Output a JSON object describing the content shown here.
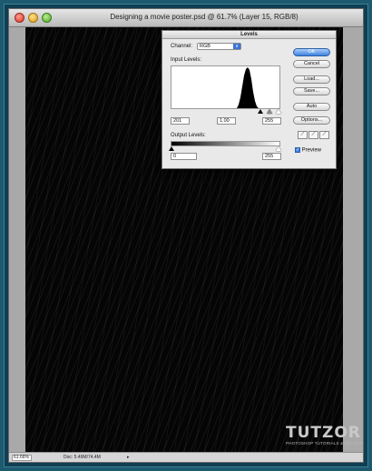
{
  "window": {
    "title": "Designing a movie poster.psd @ 61.7% (Layer 15, RGB/8)"
  },
  "statusbar": {
    "zoom": "61.66%",
    "doc_info": "Doc: 5.49M/74.4M",
    "arrow": "▸"
  },
  "watermark": {
    "logo": "TUTZOR",
    "tagline": "PHOTOSHOP TUTORIALS & BEYOND"
  },
  "levels": {
    "title": "Levels",
    "channel_label": "Channel:",
    "channel_value": "RGB",
    "channel_arrow": "⬍",
    "input_levels_label": "Input Levels:",
    "input_black": "201",
    "input_gamma": "1.00",
    "input_white": "255",
    "output_levels_label": "Output Levels:",
    "output_black": "0",
    "output_white": "255",
    "buttons": {
      "ok": "OK",
      "cancel": "Cancel",
      "load": "Load...",
      "save": "Save...",
      "auto": "Auto",
      "options": "Options..."
    },
    "preview_label": "Preview",
    "preview_checked": true,
    "check_glyph": "✓",
    "eyedroppers": [
      "black-eyedropper-icon",
      "gray-eyedropper-icon",
      "white-eyedropper-icon"
    ],
    "eyedropper_glyph": "⟋"
  },
  "colors": {
    "background": "#1d5a70",
    "canvas": "#050505",
    "accent": "#3e82e0"
  }
}
